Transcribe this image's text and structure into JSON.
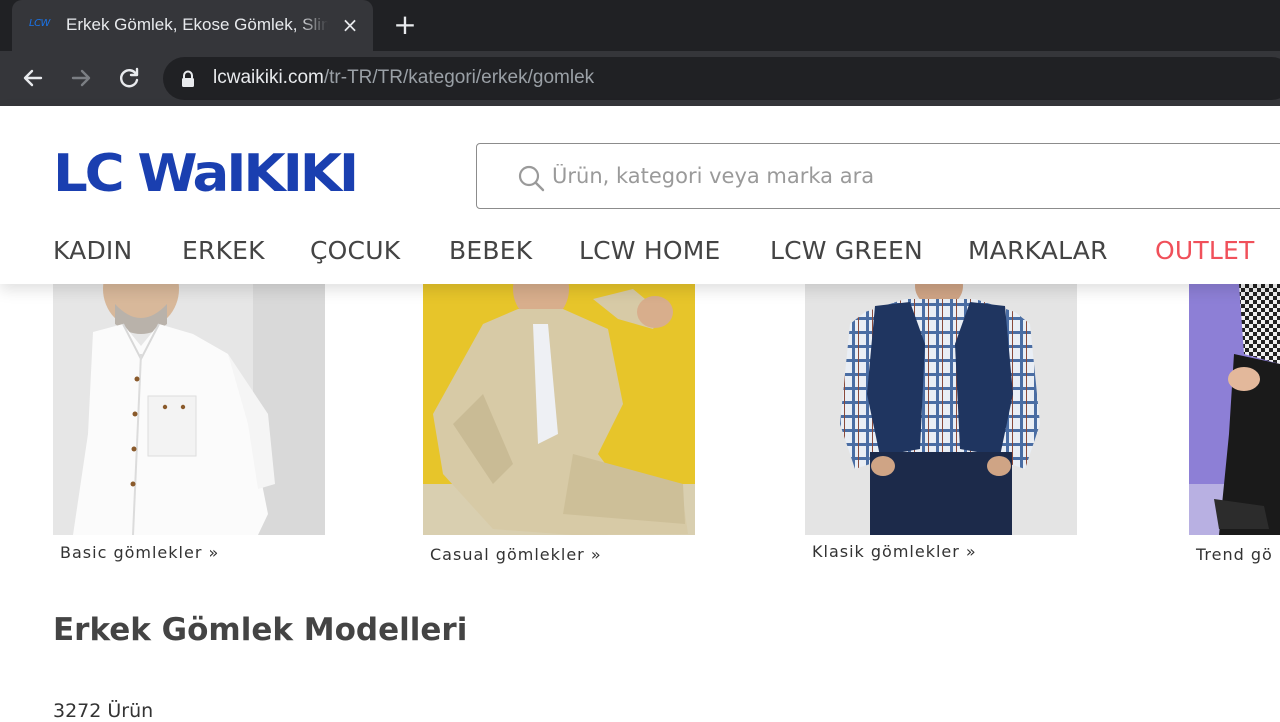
{
  "browser": {
    "tab": {
      "favicon_text": "LCW",
      "title": "Erkek Gömlek, Ekose Gömlek, Slim Fit",
      "close_glyph": "×"
    },
    "new_tab_glyph": "+",
    "url": {
      "host": "lcwaikiki.com",
      "path": "/tr-TR/TR/kategori/erkek/gomlek"
    },
    "icons": [
      "back-arrow-icon",
      "forward-arrow-icon",
      "reload-icon",
      "lock-icon"
    ]
  },
  "header": {
    "logo": "LC WaIKIKI",
    "brand_color": "#1a3fb0",
    "search": {
      "placeholder": "Ürün, kategori veya marka ara"
    },
    "nav": [
      {
        "label": "KADIN"
      },
      {
        "label": "ERKEK"
      },
      {
        "label": "ÇOCUK"
      },
      {
        "label": "BEBEK"
      },
      {
        "label": "LCW HOME"
      },
      {
        "label": "LCW GREEN"
      },
      {
        "label": "MARKALAR"
      },
      {
        "label": "OUTLET",
        "color": "#f0505a"
      }
    ]
  },
  "categories": [
    {
      "label": "Basic gömlekler »"
    },
    {
      "label": "Casual gömlekler »"
    },
    {
      "label": "Klasik gömlekler »"
    },
    {
      "label": "Trend gö"
    }
  ],
  "main": {
    "title": "Erkek Gömlek Modelleri",
    "count": "3272 Ürün"
  }
}
